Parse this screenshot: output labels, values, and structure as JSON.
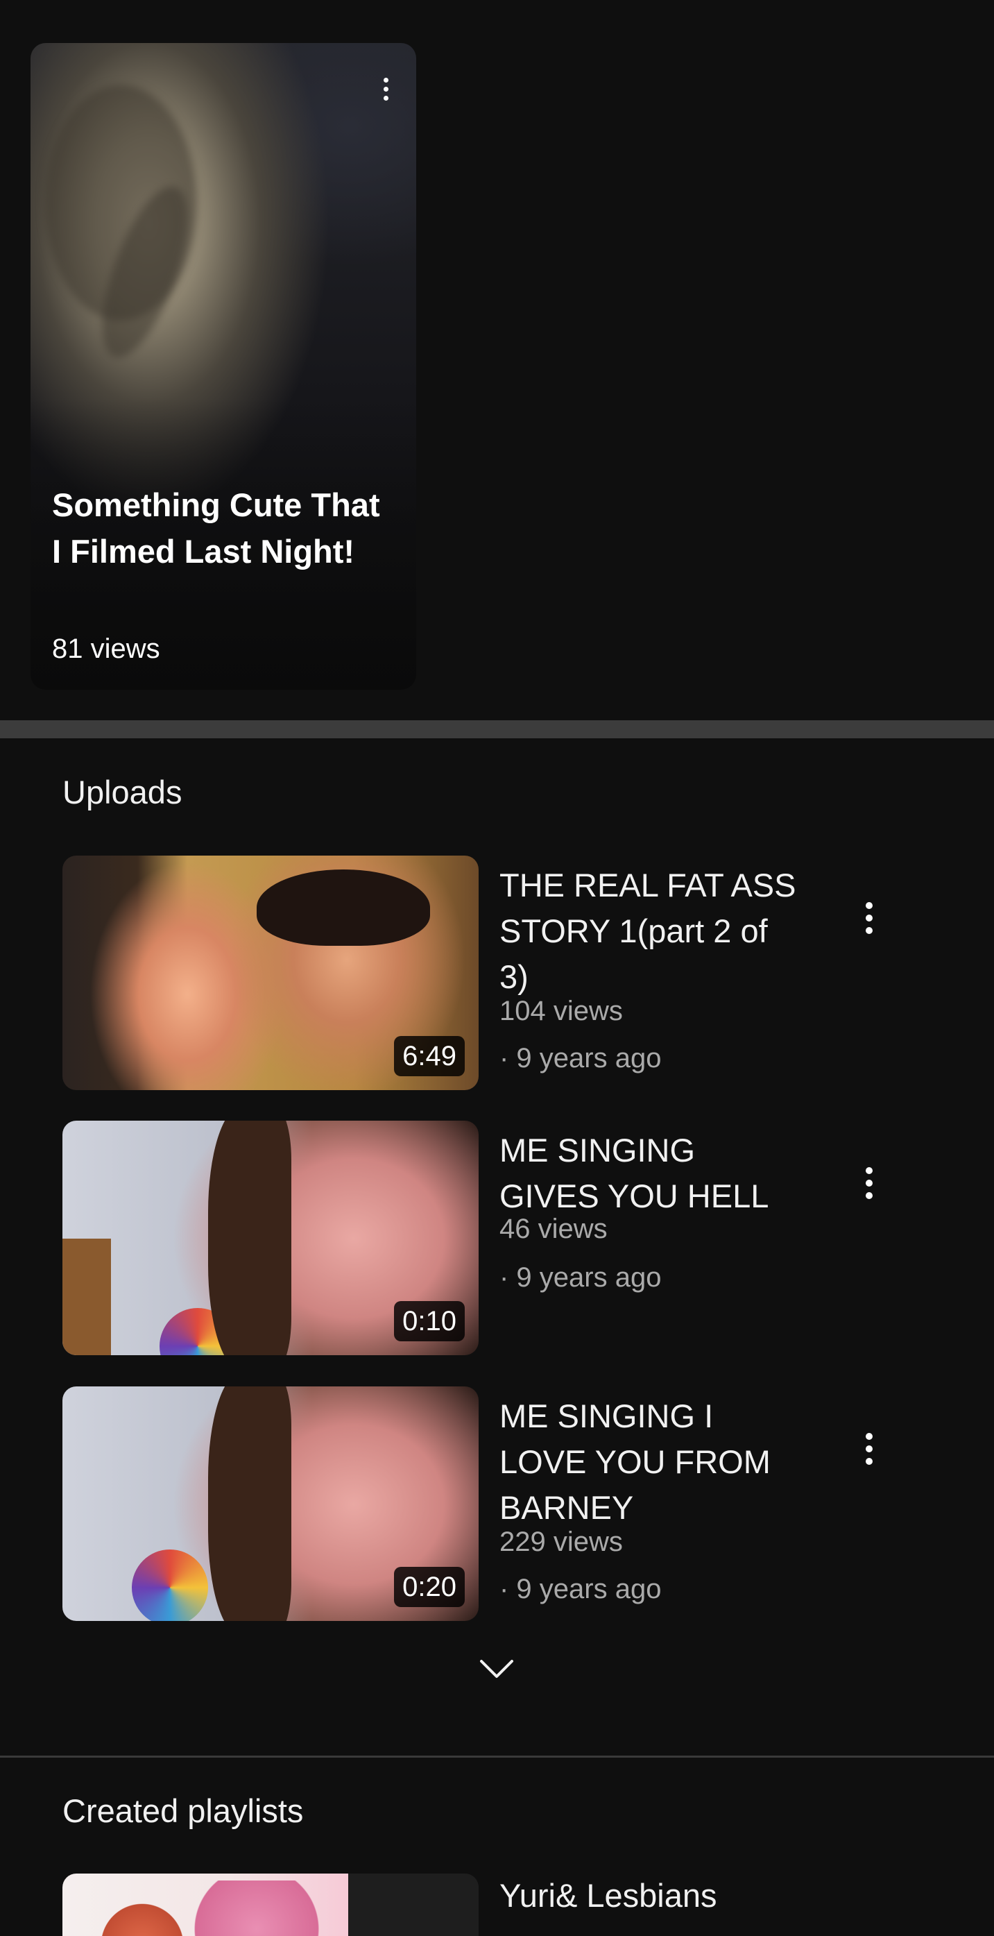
{
  "short": {
    "title": "Something Cute That I Filmed Last Night!",
    "views": "81 views",
    "menu_icon": "more-vert-icon"
  },
  "uploads": {
    "heading": "Uploads",
    "videos": [
      {
        "title": "THE REAL FAT ASS STORY 1(part 2 of 3)",
        "views": "104 views",
        "age": "· 9 years ago",
        "duration": "6:49"
      },
      {
        "title": "ME SINGING GIVES YOU HELL",
        "views": "46 views",
        "age": "· 9 years ago",
        "duration": "0:10"
      },
      {
        "title": "ME SINGING I LOVE YOU FROM BARNEY",
        "views": "229 views",
        "age": "· 9 years ago",
        "duration": "0:20"
      }
    ],
    "expand_icon": "chevron-down-icon"
  },
  "playlists": {
    "heading": "Created playlists",
    "items": [
      {
        "title": "Yuri& Lesbians"
      }
    ]
  },
  "colors": {
    "background": "#0f0f0f",
    "separator": "#3c3c3c",
    "text_primary": "#f1f1f1",
    "text_secondary": "#aaaaaa"
  }
}
